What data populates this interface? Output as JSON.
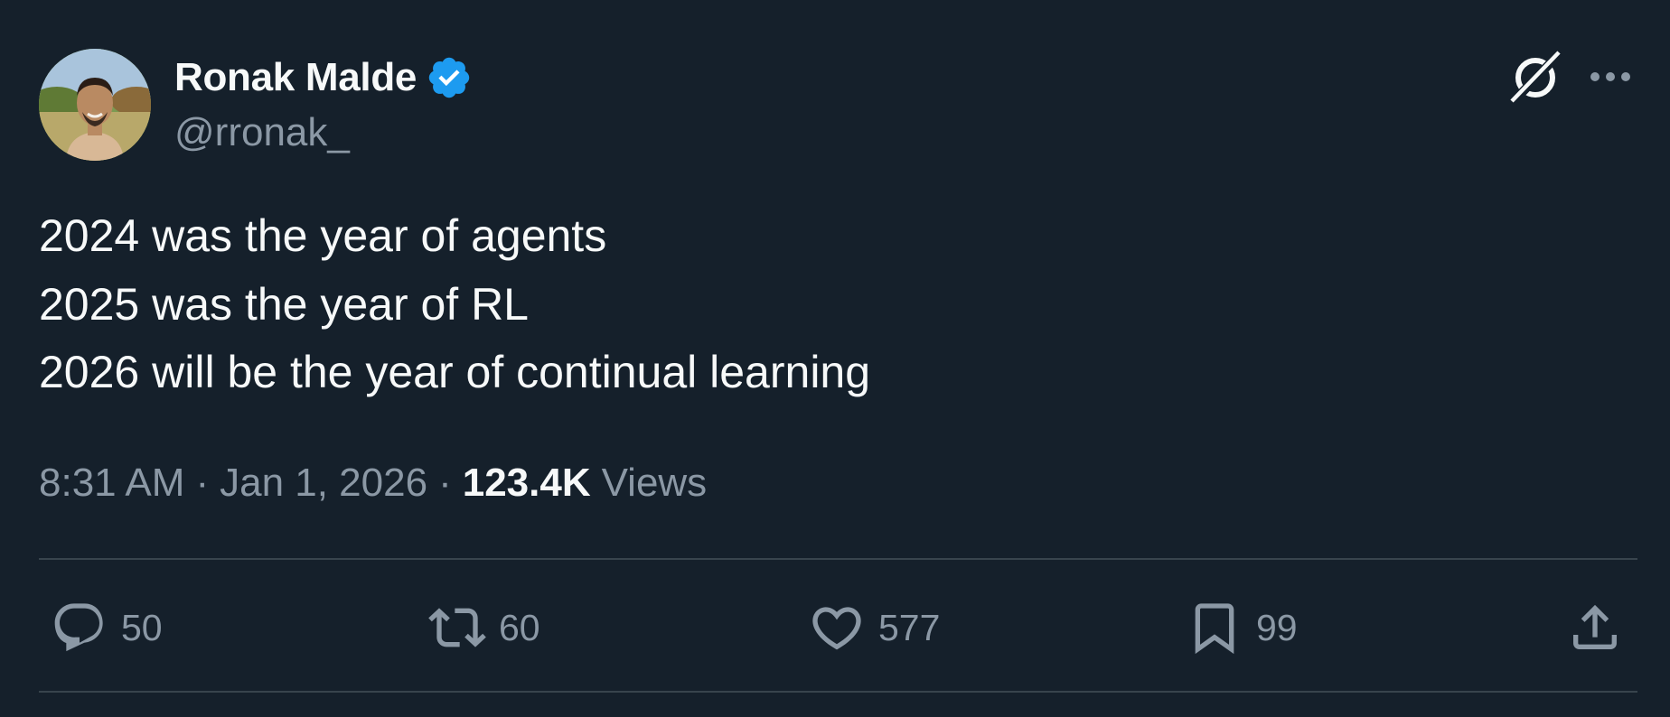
{
  "author": {
    "display_name": "Ronak Malde",
    "handle": "@rronak_",
    "verified": true
  },
  "icons": {
    "verified": "verified-badge-icon",
    "grok": "grok-icon",
    "more": "more-icon",
    "reply": "reply-icon",
    "retweet": "retweet-icon",
    "like": "heart-icon",
    "bookmark": "bookmark-icon",
    "share": "share-icon"
  },
  "tweet": {
    "lines": [
      "2024 was the year of agents",
      "2025 was the year of RL",
      "2026 will be the year of continual learning"
    ]
  },
  "meta": {
    "time": "8:31 AM",
    "separator": "·",
    "date": "Jan 1, 2026",
    "views_count": "123.4K",
    "views_label": "Views"
  },
  "actions": {
    "replies": "50",
    "retweets": "60",
    "likes": "577",
    "bookmarks": "99"
  },
  "colors": {
    "background": "#15202b",
    "text_primary": "#f7f9f9",
    "text_secondary": "#8b98a5",
    "divider": "#38444d",
    "verified_blue": "#1d9bf0"
  }
}
